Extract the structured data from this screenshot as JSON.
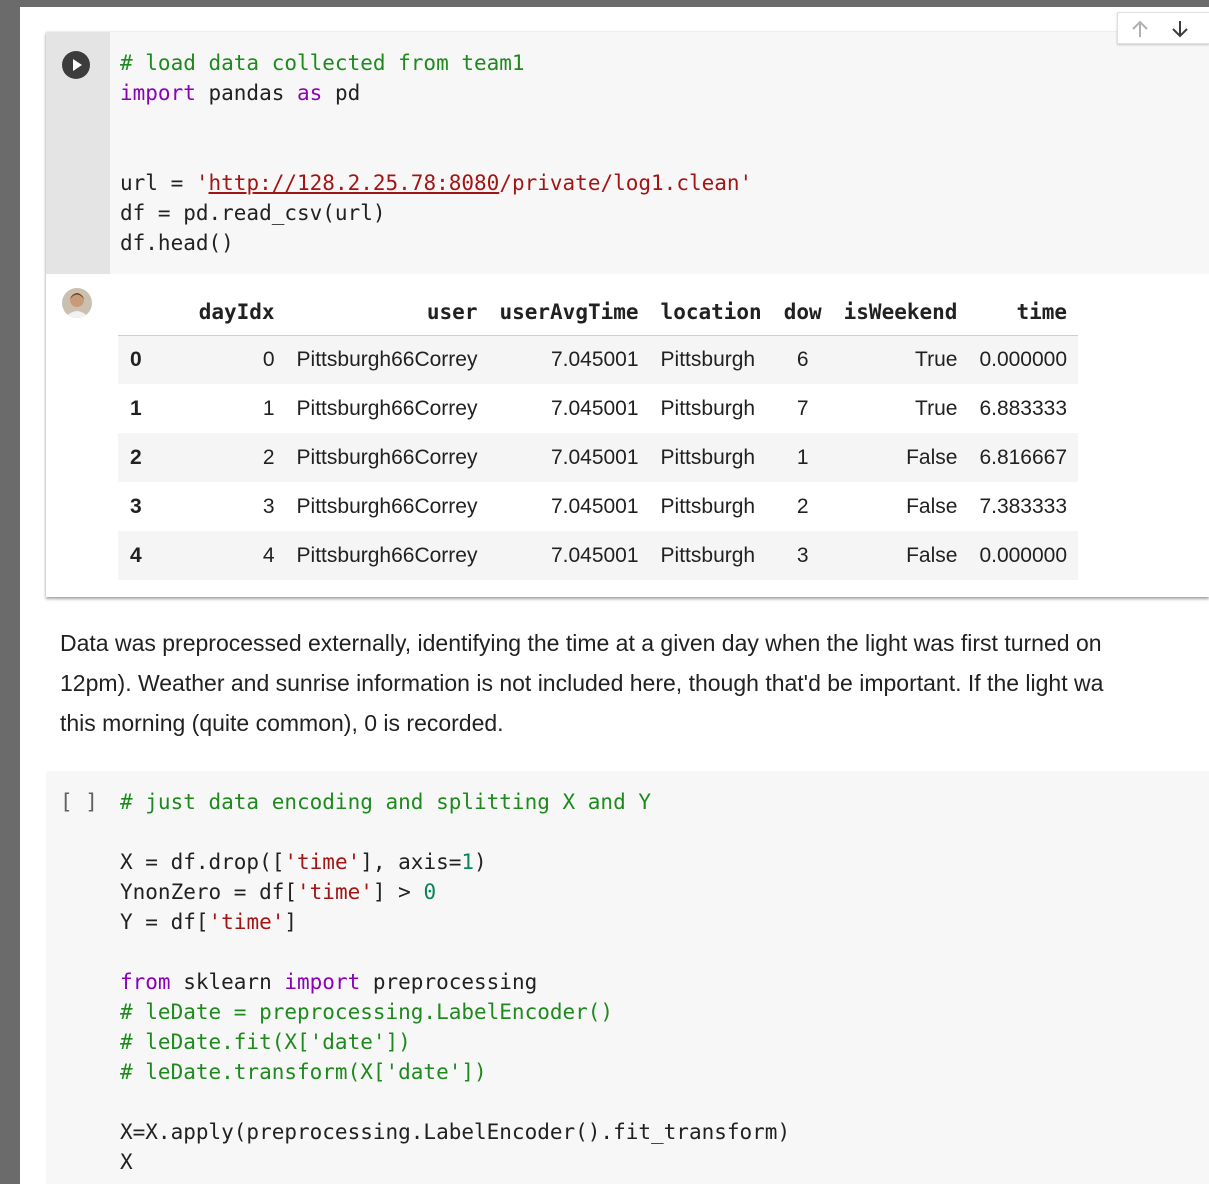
{
  "colors": {
    "keyword": "#8b00b8",
    "comment": "#1e8a1e",
    "string": "#a31515",
    "number": "#098658"
  },
  "cell1": {
    "run_icon": "play-circle-icon",
    "toolbar": {
      "up_icon": "arrow-up-icon",
      "down_icon": "arrow-down-icon"
    },
    "code": {
      "line1_comment": "# load data collected from team1",
      "line2_import": "import",
      "line2_pandas": " pandas ",
      "line2_as": "as",
      "line2_pd": " pd",
      "line5_var": "url = ",
      "line5_q1": "'",
      "line5_url": "http://128.2.25.78:8080",
      "line5_rest": "/private/log1.clean'",
      "line6": "df = pd.read_csv(url)",
      "line7": "df.head()"
    },
    "output": {
      "avatar_icon": "user-avatar",
      "columns": [
        "dayIdx",
        "user",
        "userAvgTime",
        "location",
        "dow",
        "isWeekend",
        "time"
      ],
      "rows": [
        {
          "index": "0",
          "dayIdx": "0",
          "user": "Pittsburgh66Correy",
          "userAvgTime": "7.045001",
          "location": "Pittsburgh",
          "dow": "6",
          "isWeekend": "True",
          "time": "0.000000"
        },
        {
          "index": "1",
          "dayIdx": "1",
          "user": "Pittsburgh66Correy",
          "userAvgTime": "7.045001",
          "location": "Pittsburgh",
          "dow": "7",
          "isWeekend": "True",
          "time": "6.883333"
        },
        {
          "index": "2",
          "dayIdx": "2",
          "user": "Pittsburgh66Correy",
          "userAvgTime": "7.045001",
          "location": "Pittsburgh",
          "dow": "1",
          "isWeekend": "False",
          "time": "6.816667"
        },
        {
          "index": "3",
          "dayIdx": "3",
          "user": "Pittsburgh66Correy",
          "userAvgTime": "7.045001",
          "location": "Pittsburgh",
          "dow": "2",
          "isWeekend": "False",
          "time": "7.383333"
        },
        {
          "index": "4",
          "dayIdx": "4",
          "user": "Pittsburgh66Correy",
          "userAvgTime": "7.045001",
          "location": "Pittsburgh",
          "dow": "3",
          "isWeekend": "False",
          "time": "0.000000"
        }
      ]
    }
  },
  "markdown": {
    "line1": "Data was preprocessed externally, identifying the time at a given day when the light was first turned on",
    "line2": "12pm). Weather and sunrise information is not included here, though that'd be important. If the light wa",
    "line3": "this morning (quite common), 0 is recorded."
  },
  "cell2": {
    "exec_count": "[ ]",
    "code": {
      "l1": "# just data encoding and splitting X and Y",
      "l3_a": "X = df.drop([",
      "l3_s": "'time'",
      "l3_b": "], axis=",
      "l3_n": "1",
      "l3_c": ")",
      "l4_a": "YnonZero = df[",
      "l4_s": "'time'",
      "l4_b": "] > ",
      "l4_n": "0",
      "l5_a": "Y = df[",
      "l5_s": "'time'",
      "l5_b": "]",
      "l7_from": "from",
      "l7_mod": " sklearn ",
      "l7_import": "import",
      "l7_rest": " preprocessing",
      "l8": "# leDate = preprocessing.LabelEncoder()",
      "l9": "# leDate.fit(X['date'])",
      "l10": "# leDate.transform(X['date'])",
      "l12": "X=X.apply(preprocessing.LabelEncoder().fit_transform)",
      "l13": "X"
    }
  }
}
